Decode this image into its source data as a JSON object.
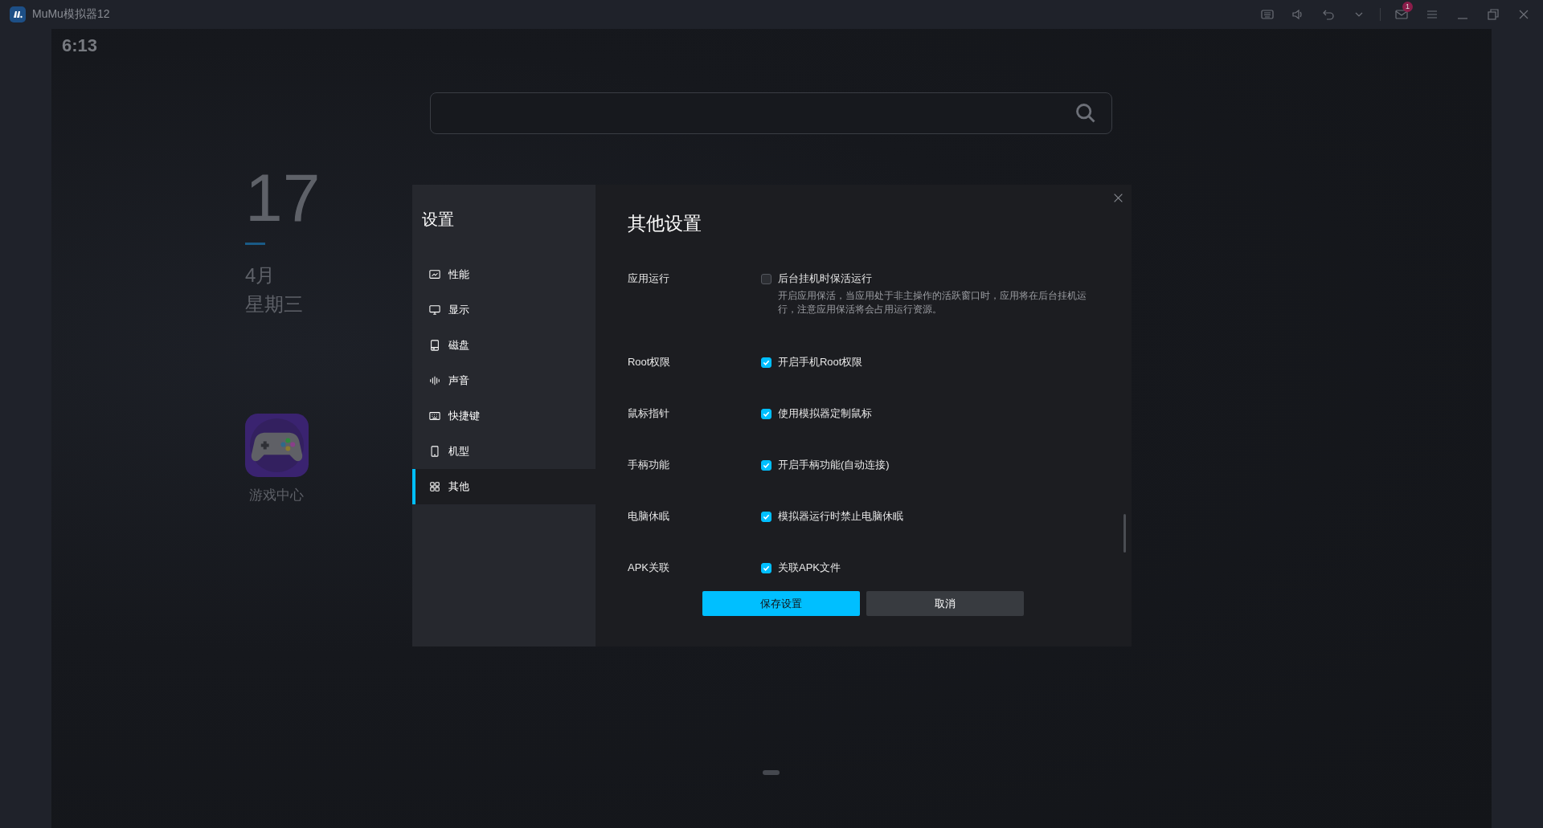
{
  "window": {
    "title": "MuMu模拟器12",
    "notification_count": "1"
  },
  "home": {
    "time": "6:13",
    "day": "17",
    "month": "4月",
    "weekday": "星期三",
    "apps": [
      {
        "label": "游戏中心"
      }
    ]
  },
  "settings": {
    "title": "设置",
    "nav": [
      {
        "label": "性能",
        "selected": false
      },
      {
        "label": "显示",
        "selected": false
      },
      {
        "label": "磁盘",
        "selected": false
      },
      {
        "label": "声音",
        "selected": false
      },
      {
        "label": "快捷键",
        "selected": false
      },
      {
        "label": "机型",
        "selected": false
      },
      {
        "label": "其他",
        "selected": true
      }
    ],
    "heading": "其他设置",
    "rows": [
      {
        "label": "应用运行",
        "option": "后台挂机时保活运行",
        "checked": false,
        "description": "开启应用保活，当应用处于非主操作的活跃窗口时，应用将在后台挂机运行，注意应用保活将会占用运行资源。"
      },
      {
        "label": "Root权限",
        "option": "开启手机Root权限",
        "checked": true
      },
      {
        "label": "鼠标指针",
        "option": "使用模拟器定制鼠标",
        "checked": true
      },
      {
        "label": "手柄功能",
        "option": "开启手柄功能(自动连接)",
        "checked": true
      },
      {
        "label": "电脑休眠",
        "option": "模拟器运行时禁止电脑休眠",
        "checked": true
      },
      {
        "label": "APK关联",
        "option": "关联APK文件",
        "checked": true
      }
    ],
    "buttons": [
      {
        "label": "保存设置",
        "kind": "primary"
      },
      {
        "label": "取消",
        "kind": "secondary"
      }
    ]
  }
}
